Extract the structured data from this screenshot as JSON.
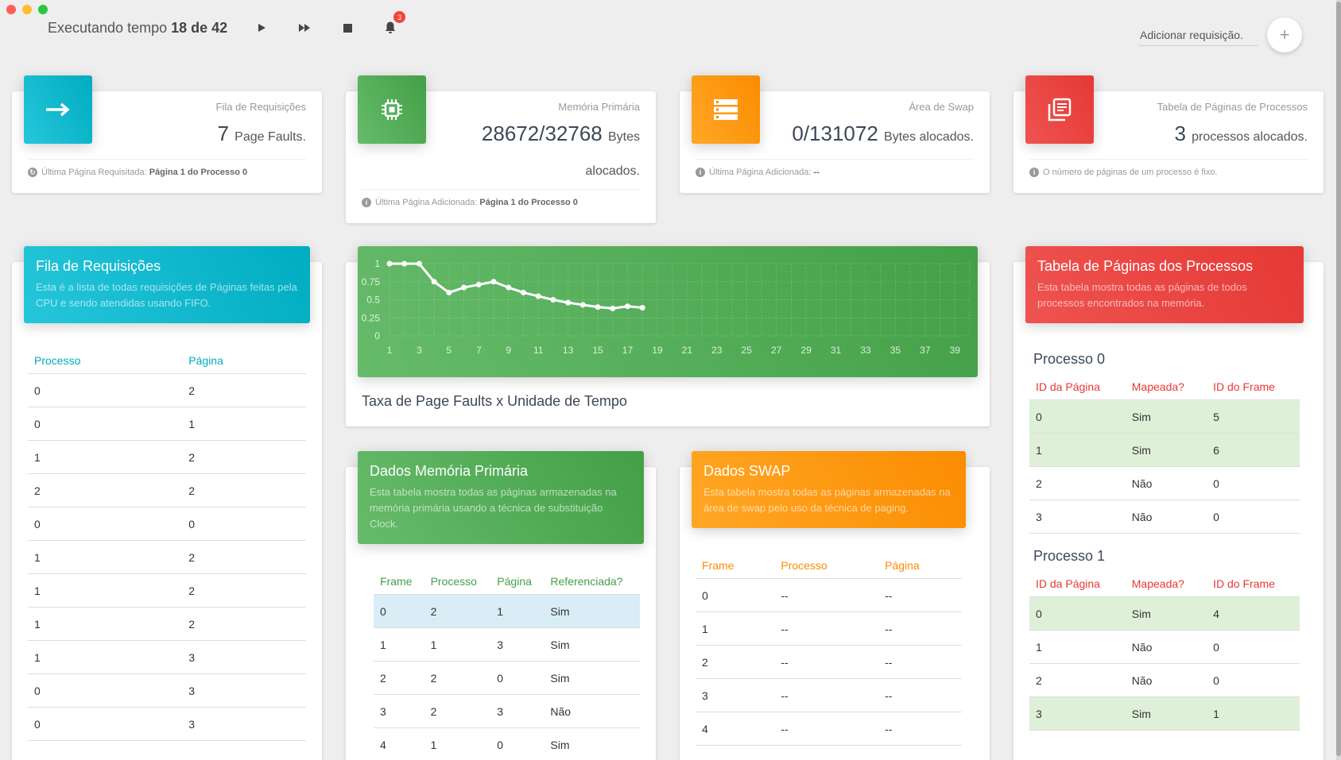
{
  "topbar": {
    "tempo_label": "Executando tempo",
    "tempo_value": "18 de 42",
    "notification_count": "3",
    "add_placeholder": "Adicionar requisição.",
    "add_symbol": "+"
  },
  "stats": [
    {
      "category": "Fila de Requisições",
      "value": "7",
      "unit": "Page Faults.",
      "footer_label": "Última Página Requisitada:",
      "footer_value": "Página 1 do Processo 0",
      "icon": "arrow-right-icon",
      "color": "#00acc1"
    },
    {
      "category": "Memória Primária",
      "value": "28672/32768",
      "unit": "Bytes alocados.",
      "footer_label": "Última Página Adicionada:",
      "footer_value": "Página 1 do Processo 0",
      "icon": "memory-chip-icon",
      "color": "#43a047"
    },
    {
      "category": "Área de Swap",
      "value": "0/131072",
      "unit": "Bytes alocados.",
      "footer_label": "Última Página Adicionada:",
      "footer_value": "--",
      "icon": "storage-icon",
      "color": "#fb8c00"
    },
    {
      "category": "Tabela de Páginas de Processos",
      "value": "3",
      "unit": "processos alocados.",
      "footer_label": "O número de páginas de um processo é fixo.",
      "footer_value": "",
      "icon": "library-books-icon",
      "color": "#e53935"
    }
  ],
  "queue": {
    "title": "Fila de Requisições",
    "subtitle": "Esta é a lista de todas requisições de Páginas feitas pela CPU e sendo atendidas usando FIFO.",
    "columns": [
      "Processo",
      "Página"
    ],
    "rows": [
      [
        "0",
        "2"
      ],
      [
        "0",
        "1"
      ],
      [
        "1",
        "2"
      ],
      [
        "2",
        "2"
      ],
      [
        "0",
        "0"
      ],
      [
        "1",
        "2"
      ],
      [
        "1",
        "2"
      ],
      [
        "1",
        "2"
      ],
      [
        "1",
        "3"
      ],
      [
        "0",
        "3"
      ],
      [
        "0",
        "3"
      ]
    ]
  },
  "chart_title": "Taxa de Page Faults x Unidade de Tempo",
  "chart_data": {
    "type": "line",
    "title": "Taxa de Page Faults x Unidade de Tempo",
    "xlabel": "",
    "ylabel": "",
    "x": [
      1,
      2,
      3,
      4,
      5,
      6,
      7,
      8,
      9,
      10,
      11,
      12,
      13,
      14,
      15,
      16,
      17,
      18
    ],
    "values": [
      1,
      1,
      1,
      0.75,
      0.6,
      0.67,
      0.71,
      0.75,
      0.67,
      0.6,
      0.55,
      0.5,
      0.46,
      0.43,
      0.4,
      0.38,
      0.41,
      0.39
    ],
    "xlim": [
      1,
      40
    ],
    "ylim": [
      0,
      1
    ],
    "x_ticks": [
      "1",
      "3",
      "5",
      "7",
      "9",
      "11",
      "13",
      "15",
      "17",
      "19",
      "21",
      "23",
      "25",
      "27",
      "29",
      "31",
      "33",
      "35",
      "37",
      "39"
    ],
    "y_ticks": [
      "0",
      "0.25",
      "0.5",
      "0.75",
      "1"
    ],
    "grid": true
  },
  "memory": {
    "title": "Dados Memória Primária",
    "subtitle": "Esta tabela mostra todas as páginas armazenadas na memória primária usando a técnica de substituição Clock.",
    "columns": [
      "Frame",
      "Processo",
      "Página",
      "Referenciada?"
    ],
    "rows": [
      [
        "0",
        "2",
        "1",
        "Sim"
      ],
      [
        "1",
        "1",
        "3",
        "Sim"
      ],
      [
        "2",
        "2",
        "0",
        "Sim"
      ],
      [
        "3",
        "2",
        "3",
        "Não"
      ],
      [
        "4",
        "1",
        "0",
        "Sim"
      ]
    ]
  },
  "swap": {
    "title": "Dados SWAP",
    "subtitle": "Esta tabela mostra todas as páginas armazenadas na área de swap pelo uso da técnica de paging.",
    "columns": [
      "Frame",
      "Processo",
      "Página"
    ],
    "rows": [
      [
        "0",
        "--",
        "--"
      ],
      [
        "1",
        "--",
        "--"
      ],
      [
        "2",
        "--",
        "--"
      ],
      [
        "3",
        "--",
        "--"
      ],
      [
        "4",
        "--",
        "--"
      ]
    ]
  },
  "pages": {
    "title": "Tabela de Páginas dos Processos",
    "subtitle": "Esta tabela mostra todas as páginas de todos processos encontrados na memória.",
    "columns": [
      "ID da Página",
      "Mapeada?",
      "ID do Frame"
    ],
    "processes": [
      {
        "name": "Processo 0",
        "rows": [
          [
            "0",
            "Sim",
            "5"
          ],
          [
            "1",
            "Sim",
            "6"
          ],
          [
            "2",
            "Não",
            "0"
          ],
          [
            "3",
            "Não",
            "0"
          ]
        ]
      },
      {
        "name": "Processo 1",
        "rows": [
          [
            "0",
            "Sim",
            "4"
          ],
          [
            "1",
            "Não",
            "0"
          ],
          [
            "2",
            "Não",
            "0"
          ],
          [
            "3",
            "Sim",
            "1"
          ]
        ]
      }
    ]
  },
  "colors": {
    "cyan": "#00acc1",
    "green": "#43a047",
    "orange": "#fb8c00",
    "red": "#e53935"
  }
}
